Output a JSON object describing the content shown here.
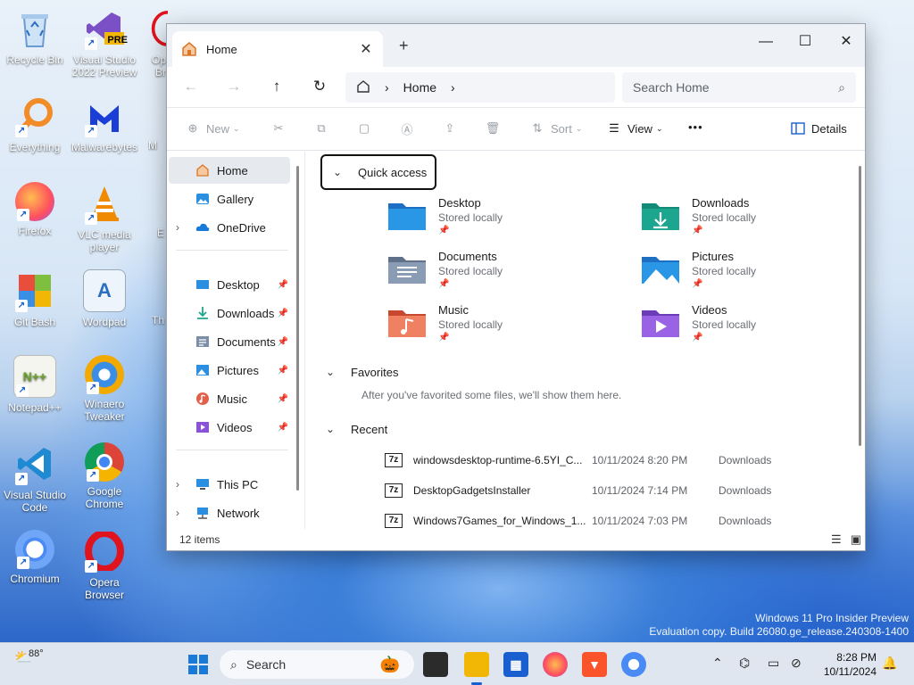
{
  "desktop": {
    "icons": [
      {
        "label": "Recycle Bin",
        "icon": "recycle-bin-icon",
        "color": "#5aa0e6"
      },
      {
        "label": "Visual Studio 2022 Preview",
        "icon": "visual-studio-icon",
        "color": "#7b4fc6",
        "badge": "PRE"
      },
      {
        "label": "Everything",
        "icon": "everything-icon",
        "color": "#f28c28"
      },
      {
        "label": "Malwarebytes",
        "icon": "malwarebytes-icon",
        "color": "#1b3fd6"
      },
      {
        "label": "Firefox",
        "icon": "firefox-icon",
        "color": "#ff7139"
      },
      {
        "label": "VLC media player",
        "icon": "vlc-icon",
        "color": "#f08a00"
      },
      {
        "label": "Git Bash",
        "icon": "git-bash-icon",
        "color": "#e84e3b"
      },
      {
        "label": "Wordpad",
        "icon": "wordpad-icon",
        "color": "#4b8ad8"
      },
      {
        "label": "Notepad++",
        "icon": "notepadpp-icon",
        "color": "#8dc63f"
      },
      {
        "label": "Winaero Tweaker",
        "icon": "winaero-icon",
        "color": "#f2a900"
      },
      {
        "label": "Visual Studio Code",
        "icon": "vscode-icon",
        "color": "#1f8ad2"
      },
      {
        "label": "Google Chrome",
        "icon": "chrome-icon",
        "color": "#db4437"
      },
      {
        "label": "Chromium",
        "icon": "chromium-icon",
        "color": "#4a8af4"
      },
      {
        "label": "Opera Browser",
        "icon": "opera-icon",
        "color": "#e0141e"
      }
    ],
    "partial_labels": [
      "Op",
      "Br",
      "M",
      "E",
      "Th"
    ],
    "watermark": {
      "line1": "Windows 11 Pro Insider Preview",
      "line2": "Evaluation copy. Build 26080.ge_release.240308-1400"
    }
  },
  "window": {
    "tab_label": "Home",
    "tab_close": "✕",
    "new_tab": "+",
    "controls": {
      "minimize": "—",
      "maximize": "☐",
      "close": "✕"
    },
    "breadcrumb": [
      "Home"
    ],
    "search_placeholder": "Search Home",
    "toolbar": {
      "new": "New",
      "sort": "Sort",
      "view": "View",
      "more": "•••",
      "details": "Details"
    },
    "nav": {
      "pinned_top": [
        {
          "label": "Home",
          "icon": "home-icon",
          "selected": true
        },
        {
          "label": "Gallery",
          "icon": "gallery-icon"
        },
        {
          "label": "OneDrive",
          "icon": "onedrive-icon",
          "expandable": true
        }
      ],
      "quick": [
        {
          "label": "Desktop",
          "icon": "desktop-folder-icon"
        },
        {
          "label": "Downloads",
          "icon": "downloads-icon"
        },
        {
          "label": "Documents",
          "icon": "documents-icon"
        },
        {
          "label": "Pictures",
          "icon": "pictures-icon"
        },
        {
          "label": "Music",
          "icon": "music-icon"
        },
        {
          "label": "Videos",
          "icon": "videos-icon"
        }
      ],
      "bottom": [
        {
          "label": "This PC",
          "icon": "this-pc-icon"
        },
        {
          "label": "Network",
          "icon": "network-icon"
        }
      ]
    },
    "sections": {
      "quick_access": "Quick access",
      "favorites": "Favorites",
      "recent": "Recent"
    },
    "quick_access": [
      {
        "name": "Desktop",
        "sub": "Stored locally",
        "color": "#1f8fe0"
      },
      {
        "name": "Downloads",
        "sub": "Stored locally",
        "color": "#1ca58f"
      },
      {
        "name": "Documents",
        "sub": "Stored locally",
        "color": "#7c8ea6"
      },
      {
        "name": "Pictures",
        "sub": "Stored locally",
        "color": "#2a8fe0"
      },
      {
        "name": "Music",
        "sub": "Stored locally",
        "color": "#e2604a"
      },
      {
        "name": "Videos",
        "sub": "Stored locally",
        "color": "#8a52d6"
      }
    ],
    "favorites_note": "After you've favorited some files, we'll show them here.",
    "recent": [
      {
        "name": "windowsdesktop-runtime-6.5YI_C...",
        "date": "10/11/2024 8:20 PM",
        "location": "Downloads"
      },
      {
        "name": "DesktopGadgetsInstaller",
        "date": "10/11/2024 7:14 PM",
        "location": "Downloads"
      },
      {
        "name": "Windows7Games_for_Windows_1...",
        "date": "10/11/2024 7:03 PM",
        "location": "Downloads"
      }
    ],
    "recent_icon_text": "7z",
    "status": "12 items"
  },
  "taskbar": {
    "weather": "88°",
    "search": "Search",
    "time": "8:28 PM",
    "date": "10/11/2024"
  }
}
